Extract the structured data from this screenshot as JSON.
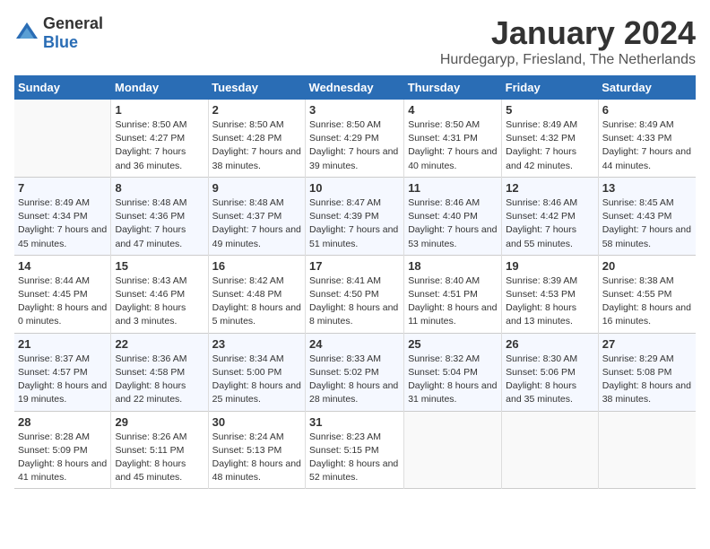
{
  "header": {
    "logo_general": "General",
    "logo_blue": "Blue",
    "month_title": "January 2024",
    "location": "Hurdegaryp, Friesland, The Netherlands"
  },
  "weekdays": [
    "Sunday",
    "Monday",
    "Tuesday",
    "Wednesday",
    "Thursday",
    "Friday",
    "Saturday"
  ],
  "weeks": [
    [
      {
        "day": "",
        "sunrise": "",
        "sunset": "",
        "daylight": ""
      },
      {
        "day": "1",
        "sunrise": "Sunrise: 8:50 AM",
        "sunset": "Sunset: 4:27 PM",
        "daylight": "Daylight: 7 hours and 36 minutes."
      },
      {
        "day": "2",
        "sunrise": "Sunrise: 8:50 AM",
        "sunset": "Sunset: 4:28 PM",
        "daylight": "Daylight: 7 hours and 38 minutes."
      },
      {
        "day": "3",
        "sunrise": "Sunrise: 8:50 AM",
        "sunset": "Sunset: 4:29 PM",
        "daylight": "Daylight: 7 hours and 39 minutes."
      },
      {
        "day": "4",
        "sunrise": "Sunrise: 8:50 AM",
        "sunset": "Sunset: 4:31 PM",
        "daylight": "Daylight: 7 hours and 40 minutes."
      },
      {
        "day": "5",
        "sunrise": "Sunrise: 8:49 AM",
        "sunset": "Sunset: 4:32 PM",
        "daylight": "Daylight: 7 hours and 42 minutes."
      },
      {
        "day": "6",
        "sunrise": "Sunrise: 8:49 AM",
        "sunset": "Sunset: 4:33 PM",
        "daylight": "Daylight: 7 hours and 44 minutes."
      }
    ],
    [
      {
        "day": "7",
        "sunrise": "Sunrise: 8:49 AM",
        "sunset": "Sunset: 4:34 PM",
        "daylight": "Daylight: 7 hours and 45 minutes."
      },
      {
        "day": "8",
        "sunrise": "Sunrise: 8:48 AM",
        "sunset": "Sunset: 4:36 PM",
        "daylight": "Daylight: 7 hours and 47 minutes."
      },
      {
        "day": "9",
        "sunrise": "Sunrise: 8:48 AM",
        "sunset": "Sunset: 4:37 PM",
        "daylight": "Daylight: 7 hours and 49 minutes."
      },
      {
        "day": "10",
        "sunrise": "Sunrise: 8:47 AM",
        "sunset": "Sunset: 4:39 PM",
        "daylight": "Daylight: 7 hours and 51 minutes."
      },
      {
        "day": "11",
        "sunrise": "Sunrise: 8:46 AM",
        "sunset": "Sunset: 4:40 PM",
        "daylight": "Daylight: 7 hours and 53 minutes."
      },
      {
        "day": "12",
        "sunrise": "Sunrise: 8:46 AM",
        "sunset": "Sunset: 4:42 PM",
        "daylight": "Daylight: 7 hours and 55 minutes."
      },
      {
        "day": "13",
        "sunrise": "Sunrise: 8:45 AM",
        "sunset": "Sunset: 4:43 PM",
        "daylight": "Daylight: 7 hours and 58 minutes."
      }
    ],
    [
      {
        "day": "14",
        "sunrise": "Sunrise: 8:44 AM",
        "sunset": "Sunset: 4:45 PM",
        "daylight": "Daylight: 8 hours and 0 minutes."
      },
      {
        "day": "15",
        "sunrise": "Sunrise: 8:43 AM",
        "sunset": "Sunset: 4:46 PM",
        "daylight": "Daylight: 8 hours and 3 minutes."
      },
      {
        "day": "16",
        "sunrise": "Sunrise: 8:42 AM",
        "sunset": "Sunset: 4:48 PM",
        "daylight": "Daylight: 8 hours and 5 minutes."
      },
      {
        "day": "17",
        "sunrise": "Sunrise: 8:41 AM",
        "sunset": "Sunset: 4:50 PM",
        "daylight": "Daylight: 8 hours and 8 minutes."
      },
      {
        "day": "18",
        "sunrise": "Sunrise: 8:40 AM",
        "sunset": "Sunset: 4:51 PM",
        "daylight": "Daylight: 8 hours and 11 minutes."
      },
      {
        "day": "19",
        "sunrise": "Sunrise: 8:39 AM",
        "sunset": "Sunset: 4:53 PM",
        "daylight": "Daylight: 8 hours and 13 minutes."
      },
      {
        "day": "20",
        "sunrise": "Sunrise: 8:38 AM",
        "sunset": "Sunset: 4:55 PM",
        "daylight": "Daylight: 8 hours and 16 minutes."
      }
    ],
    [
      {
        "day": "21",
        "sunrise": "Sunrise: 8:37 AM",
        "sunset": "Sunset: 4:57 PM",
        "daylight": "Daylight: 8 hours and 19 minutes."
      },
      {
        "day": "22",
        "sunrise": "Sunrise: 8:36 AM",
        "sunset": "Sunset: 4:58 PM",
        "daylight": "Daylight: 8 hours and 22 minutes."
      },
      {
        "day": "23",
        "sunrise": "Sunrise: 8:34 AM",
        "sunset": "Sunset: 5:00 PM",
        "daylight": "Daylight: 8 hours and 25 minutes."
      },
      {
        "day": "24",
        "sunrise": "Sunrise: 8:33 AM",
        "sunset": "Sunset: 5:02 PM",
        "daylight": "Daylight: 8 hours and 28 minutes."
      },
      {
        "day": "25",
        "sunrise": "Sunrise: 8:32 AM",
        "sunset": "Sunset: 5:04 PM",
        "daylight": "Daylight: 8 hours and 31 minutes."
      },
      {
        "day": "26",
        "sunrise": "Sunrise: 8:30 AM",
        "sunset": "Sunset: 5:06 PM",
        "daylight": "Daylight: 8 hours and 35 minutes."
      },
      {
        "day": "27",
        "sunrise": "Sunrise: 8:29 AM",
        "sunset": "Sunset: 5:08 PM",
        "daylight": "Daylight: 8 hours and 38 minutes."
      }
    ],
    [
      {
        "day": "28",
        "sunrise": "Sunrise: 8:28 AM",
        "sunset": "Sunset: 5:09 PM",
        "daylight": "Daylight: 8 hours and 41 minutes."
      },
      {
        "day": "29",
        "sunrise": "Sunrise: 8:26 AM",
        "sunset": "Sunset: 5:11 PM",
        "daylight": "Daylight: 8 hours and 45 minutes."
      },
      {
        "day": "30",
        "sunrise": "Sunrise: 8:24 AM",
        "sunset": "Sunset: 5:13 PM",
        "daylight": "Daylight: 8 hours and 48 minutes."
      },
      {
        "day": "31",
        "sunrise": "Sunrise: 8:23 AM",
        "sunset": "Sunset: 5:15 PM",
        "daylight": "Daylight: 8 hours and 52 minutes."
      },
      {
        "day": "",
        "sunrise": "",
        "sunset": "",
        "daylight": ""
      },
      {
        "day": "",
        "sunrise": "",
        "sunset": "",
        "daylight": ""
      },
      {
        "day": "",
        "sunrise": "",
        "sunset": "",
        "daylight": ""
      }
    ]
  ]
}
